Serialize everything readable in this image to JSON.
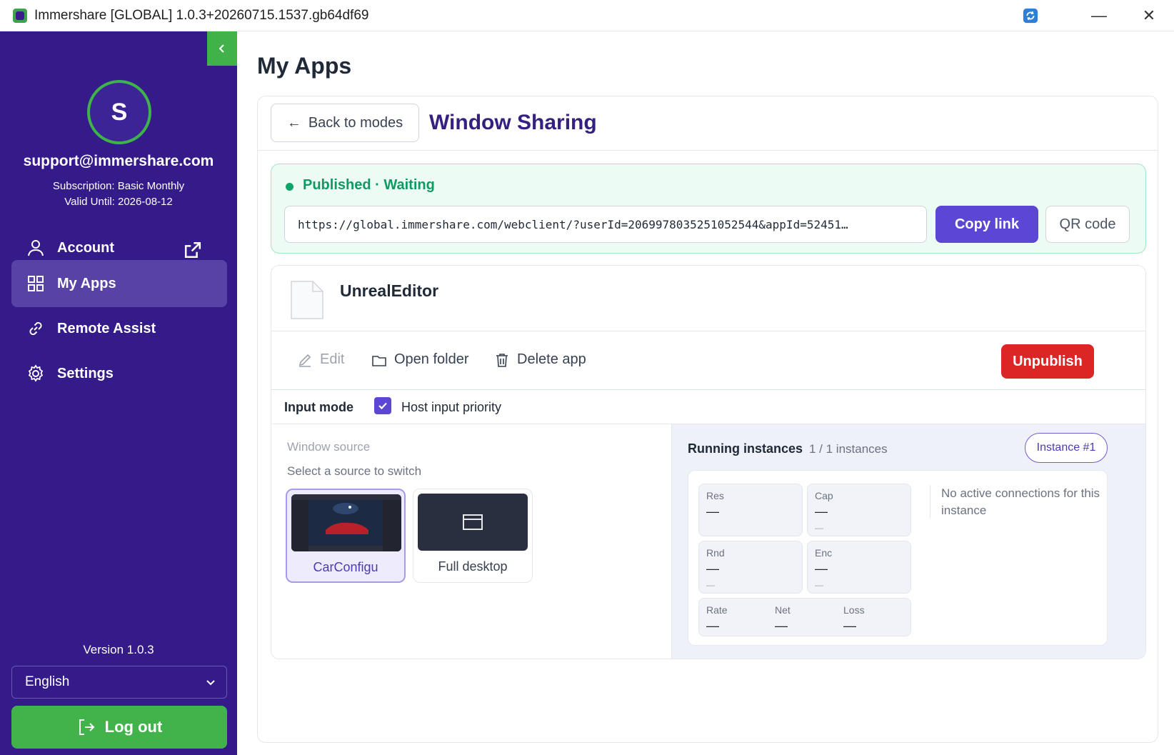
{
  "window": {
    "title": "Immershare [GLOBAL] 1.0.3+20260715.1537.gb64df69",
    "minimize": "—",
    "close": "✕"
  },
  "sidebar": {
    "avatar_initial": "S",
    "email": "support@immershare.com",
    "subscription": "Subscription: Basic Monthly",
    "valid_until": "Valid Until: 2026-08-12",
    "nav": [
      {
        "label": "Account",
        "icon": "user-icon"
      },
      {
        "label": "My Apps",
        "icon": "grid-icon",
        "active": true
      },
      {
        "label": "Remote Assist",
        "icon": "link-icon"
      },
      {
        "label": "Settings",
        "icon": "gear-icon"
      }
    ],
    "version": "Version 1.0.3",
    "language": "English",
    "logout": "Log out"
  },
  "main": {
    "page_title": "My Apps",
    "back_label": "Back to modes",
    "mode_title": "Window Sharing",
    "publish": {
      "status": "Published · Waiting",
      "url": "https://global.immershare.com/webclient/?userId=2069978035251052544&appId=52451…",
      "copy_label": "Copy link",
      "qr_label": "QR code"
    },
    "app": {
      "name": "UnrealEditor",
      "edit_label": "Edit",
      "open_folder_label": "Open folder",
      "delete_label": "Delete app",
      "unpublish_label": "Unpublish",
      "input_mode_label": "Input mode",
      "host_priority_label": "Host input priority",
      "host_priority_checked": true
    },
    "source": {
      "title": "Window source",
      "hint": "Select a source to switch",
      "options": [
        {
          "label": "CarConfigu",
          "selected": true
        },
        {
          "label": "Full desktop",
          "selected": false
        }
      ]
    },
    "instances": {
      "title": "Running instances",
      "count": "1 / 1 instances",
      "instance_label": "Instance #1",
      "stats": {
        "res": {
          "label": "Res",
          "value": "—"
        },
        "cap": {
          "label": "Cap",
          "value": "—",
          "sub": "—"
        },
        "rnd": {
          "label": "Rnd",
          "value": "—",
          "sub": "—"
        },
        "enc": {
          "label": "Enc",
          "value": "—",
          "sub": "—"
        },
        "rate": {
          "label": "Rate",
          "value": "—"
        },
        "net": {
          "label": "Net",
          "value": "—"
        },
        "loss": {
          "label": "Loss",
          "value": "—"
        }
      },
      "no_connections": "No active connections for this instance"
    }
  },
  "colors": {
    "sidebar_bg": "#351a8a",
    "accent_green": "#42b34b",
    "primary_purple": "#5b47d4",
    "danger_red": "#dc2626",
    "published_green": "#0e9a63"
  }
}
